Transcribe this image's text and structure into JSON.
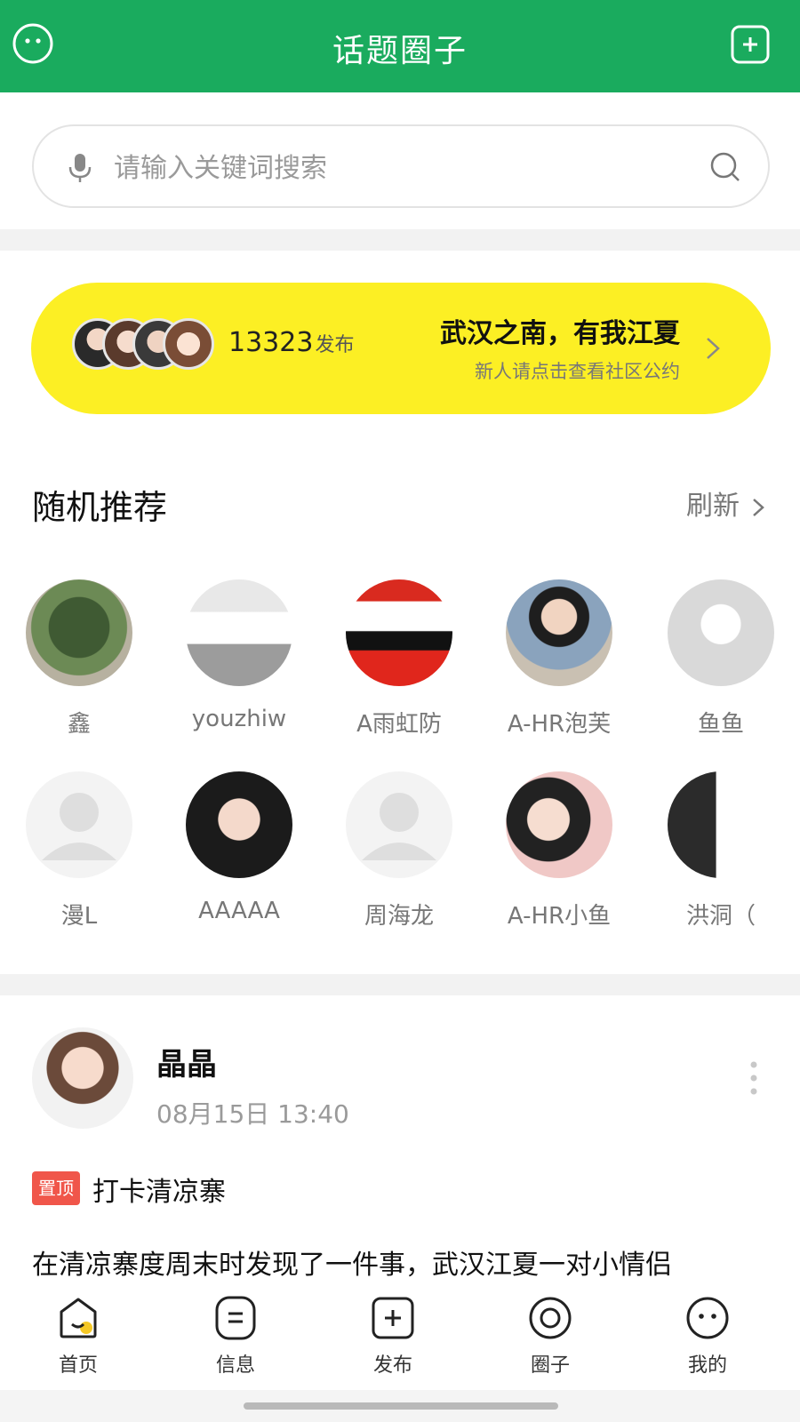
{
  "header": {
    "title": "话题圈子"
  },
  "search": {
    "placeholder": "请输入关键词搜索"
  },
  "banner": {
    "count": "13323",
    "count_unit": "发布",
    "title": "武汉之南，有我江夏",
    "subtitle": "新人请点击查看社区公约"
  },
  "recommend": {
    "title": "随机推荐",
    "refresh_label": "刷新",
    "users": [
      {
        "name": "鑫"
      },
      {
        "name": "youzhiw"
      },
      {
        "name": "A雨虹防"
      },
      {
        "name": "A-HR泡芙"
      },
      {
        "name": "鱼鱼"
      },
      {
        "name": "漫L"
      },
      {
        "name": "AAAAA"
      },
      {
        "name": "周海龙"
      },
      {
        "name": "A-HR小鱼"
      },
      {
        "name": "洪洞（"
      }
    ]
  },
  "post": {
    "author": "晶晶",
    "time": "08月15日 13:40",
    "pin_label": "置顶",
    "title": "打卡清凉寨",
    "body": "在清凉寨度周末时发现了一件事，武汉江夏一对小情侣"
  },
  "tabs": [
    {
      "label": "首页",
      "icon": "home-icon"
    },
    {
      "label": "信息",
      "icon": "message-icon"
    },
    {
      "label": "发布",
      "icon": "publish-icon"
    },
    {
      "label": "圈子",
      "icon": "circle-icon"
    },
    {
      "label": "我的",
      "icon": "profile-icon"
    }
  ],
  "colors": {
    "brand_green": "#1aab5e",
    "banner_yellow": "#fcef24",
    "pin_red": "#f0564a"
  }
}
